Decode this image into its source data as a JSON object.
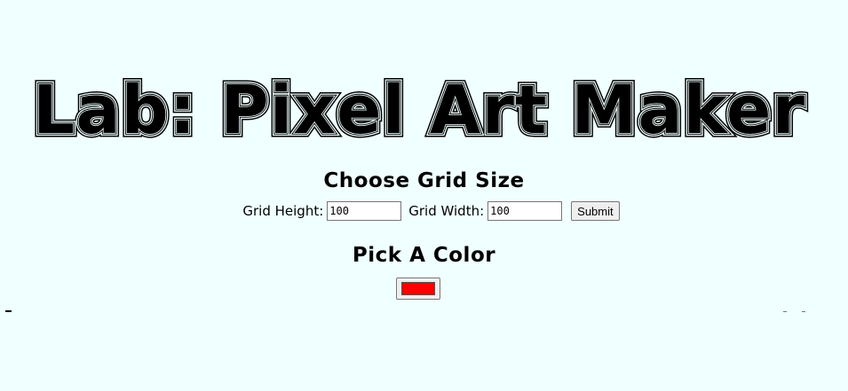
{
  "page_title": "Lab: Pixel Art Maker",
  "grid_section": {
    "heading": "Choose Grid Size",
    "height_label": "Grid Height:",
    "height_value": "100",
    "width_label": "Grid Width:",
    "width_value": "100",
    "submit_label": "Submit"
  },
  "color_section": {
    "heading": "Pick A Color",
    "selected_color": "#ff0000"
  },
  "colors": {
    "background": "#f0ffff",
    "title": "#000000"
  }
}
